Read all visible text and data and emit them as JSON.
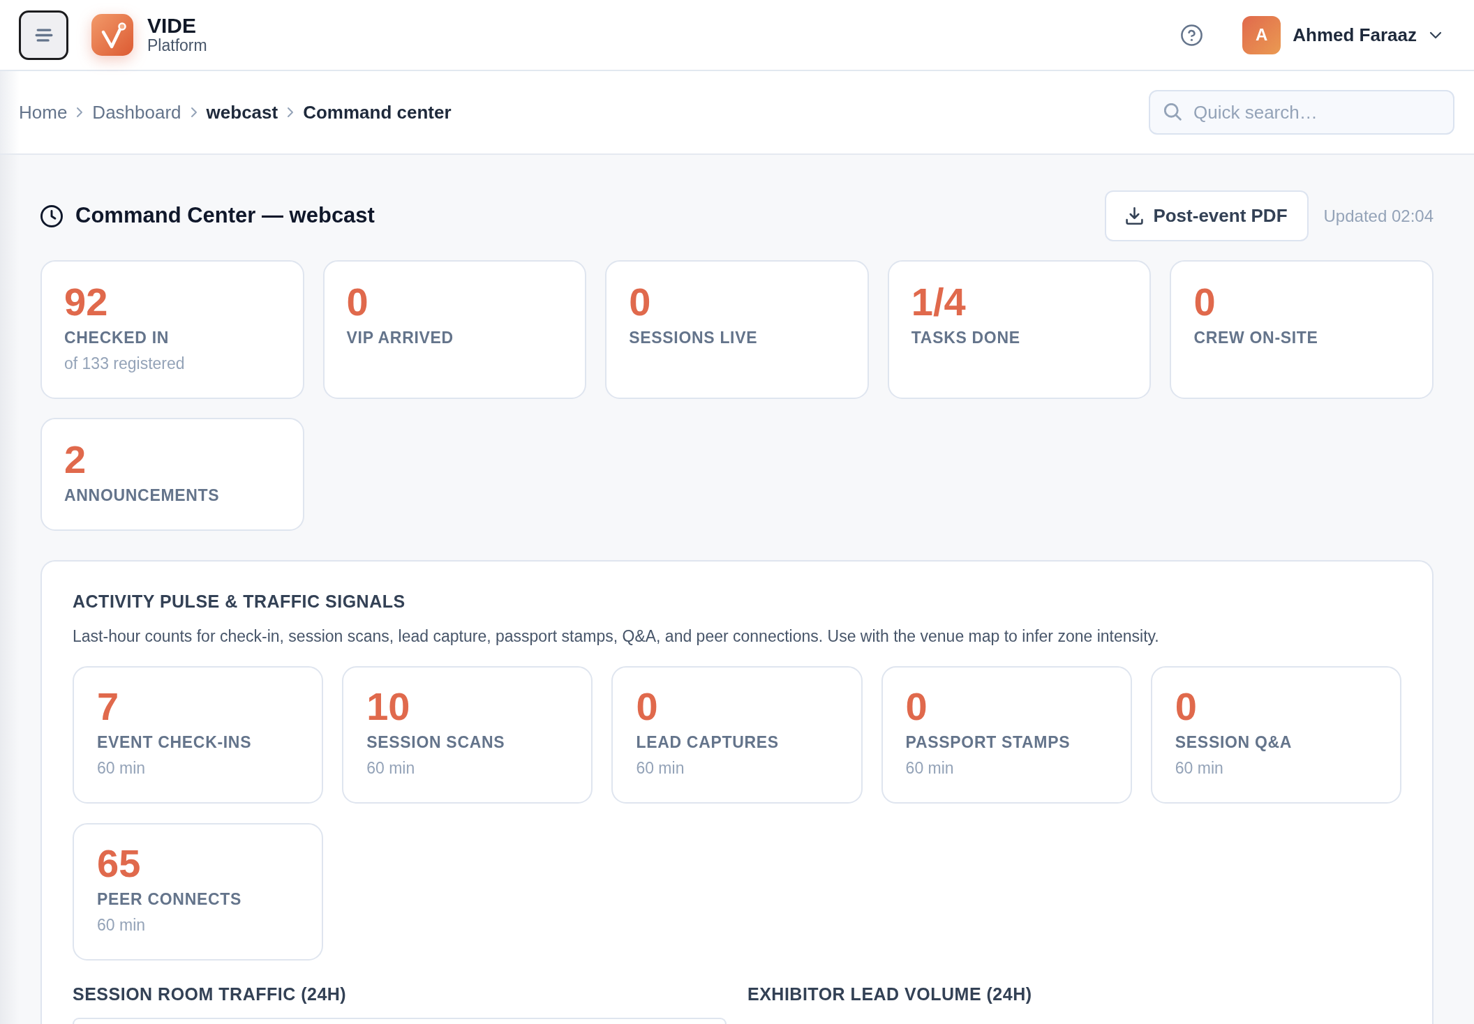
{
  "header": {
    "brand": {
      "name": "VIDE",
      "subtitle": "Platform"
    },
    "user": {
      "initial": "A",
      "name": "Ahmed Faraaz"
    }
  },
  "breadcrumb": [
    {
      "label": "Home",
      "emphasized": false
    },
    {
      "label": "Dashboard",
      "emphasized": false
    },
    {
      "label": "webcast",
      "emphasized": true
    },
    {
      "label": "Command center",
      "emphasized": true
    }
  ],
  "search": {
    "placeholder": "Quick search…"
  },
  "page": {
    "title": "Command Center — webcast",
    "export_button": "Post-event PDF",
    "updated": "Updated 02:04"
  },
  "stats": [
    {
      "value": "92",
      "label": "CHECKED IN",
      "note": "of 133 registered"
    },
    {
      "value": "0",
      "label": "VIP ARRIVED"
    },
    {
      "value": "0",
      "label": "SESSIONS LIVE"
    },
    {
      "value": "1/4",
      "label": "TASKS DONE"
    },
    {
      "value": "0",
      "label": "CREW ON-SITE"
    },
    {
      "value": "2",
      "label": "ANNOUNCEMENTS"
    }
  ],
  "activity": {
    "title": "ACTIVITY PULSE & TRAFFIC SIGNALS",
    "description": "Last-hour counts for check-in, session scans, lead capture, passport stamps, Q&A, and peer connections. Use with the venue map to infer zone intensity.",
    "metrics": [
      {
        "value": "7",
        "label": "EVENT CHECK-INS",
        "note": "60 min"
      },
      {
        "value": "10",
        "label": "SESSION SCANS",
        "note": "60 min"
      },
      {
        "value": "0",
        "label": "LEAD CAPTURES",
        "note": "60 min"
      },
      {
        "value": "0",
        "label": "PASSPORT STAMPS",
        "note": "60 min"
      },
      {
        "value": "0",
        "label": "SESSION Q&A",
        "note": "60 min"
      },
      {
        "value": "65",
        "label": "PEER CONNECTS",
        "note": "60 min"
      }
    ],
    "panels": [
      {
        "title": "SESSION ROOM TRAFFIC (24H)",
        "boxed": true
      },
      {
        "title": "EXHIBITOR LEAD VOLUME (24H)",
        "boxed": false
      }
    ]
  }
}
